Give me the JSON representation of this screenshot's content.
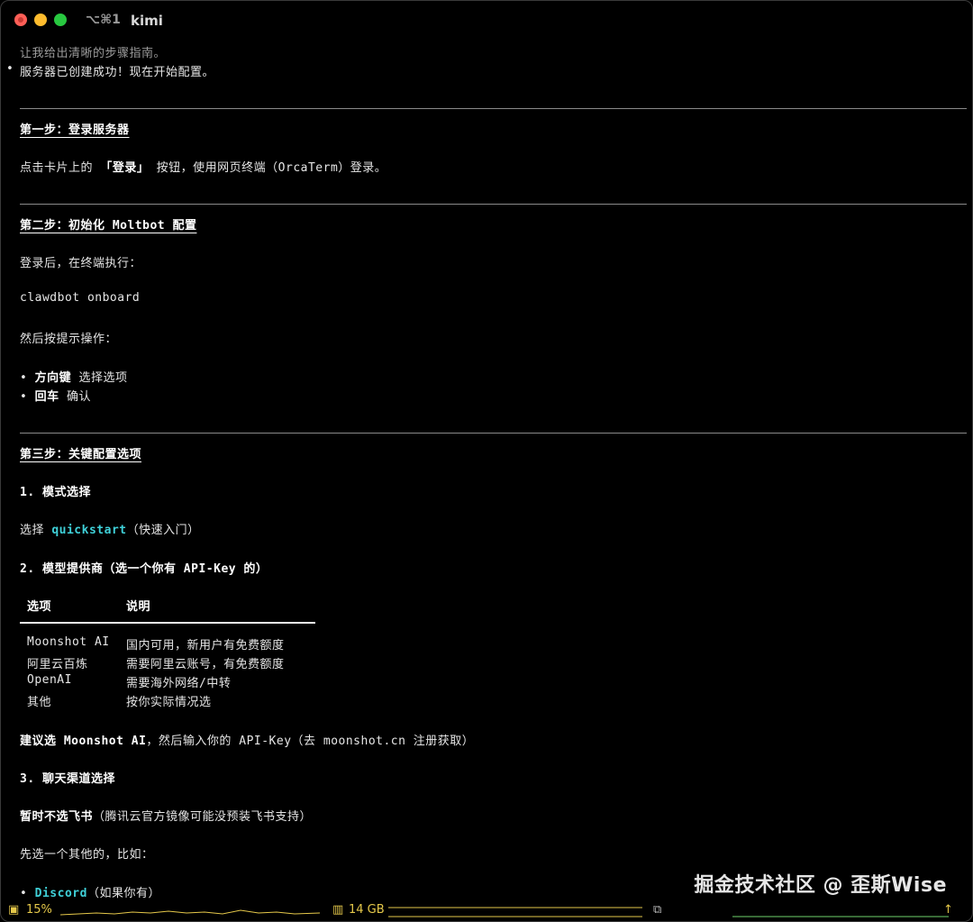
{
  "window": {
    "tab_shortcut": "⌥⌘1",
    "tab_title": "kimi"
  },
  "terminal": {
    "intro": "让我给出清晰的步骤指南。",
    "created": "服务器已创建成功！现在开始配置。",
    "step1": {
      "heading": "第一步：登录服务器",
      "text_a": "点击卡片上的 ",
      "text_b": "「登录」",
      "text_c": " 按钮，使用网页终端（OrcaTerm）登录。"
    },
    "step2": {
      "heading": "第二步：初始化 Moltbot 配置",
      "after_login": "登录后，在终端执行：",
      "command": "clawdbot onboard",
      "then": "然后按提示操作：",
      "bullets": [
        {
          "bold": "方向键",
          "text": " 选择选项"
        },
        {
          "bold": "回车",
          "text": " 确认"
        }
      ]
    },
    "step3": {
      "heading": "第三步：关键配置选项",
      "mode_title": "1. 模式选择",
      "mode_a": "选择 ",
      "mode_b": "quickstart",
      "mode_c": "（快速入门）",
      "provider_title": "2. 模型提供商（选一个你有 API-Key 的）",
      "table": {
        "headers": [
          "选项",
          "说明"
        ],
        "rows": [
          [
            "Moonshot AI",
            "国内可用，新用户有免费额度"
          ],
          [
            "阿里云百炼",
            "需要阿里云账号，有免费额度"
          ],
          [
            "OpenAI",
            "需要海外网络/中转"
          ],
          [
            "其他",
            "按你实际情况选"
          ]
        ]
      },
      "suggest_a": "建议选 Moonshot AI",
      "suggest_b": "，然后输入你的 API-Key（去 moonshot.cn 注册获取）",
      "channel_title": "3. 聊天渠道选择",
      "channel_a": "暂时不选飞书",
      "channel_b": "（腾讯云官方镜像可能没预装飞书支持）",
      "first_pick": "先选一个其他的，比如：",
      "discord_a": "Discord",
      "discord_b": "（如果你有）"
    }
  },
  "statusbar": {
    "cpu": "15%",
    "mem": "14 GB",
    "colors": {
      "accent": "#e5c84a"
    }
  },
  "watermark": "掘金技术社区 @ 歪斯Wise"
}
